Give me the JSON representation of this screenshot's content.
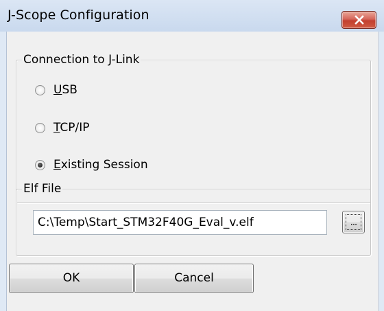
{
  "window": {
    "title": "J-Scope Configuration",
    "close_icon": "close-x-icon",
    "accent_close": "#c8412f"
  },
  "connection": {
    "legend": "Connection to J-Link",
    "options": [
      {
        "prefix": "",
        "mnemonic": "U",
        "rest": "SB",
        "checked": false
      },
      {
        "prefix": "",
        "mnemonic": "T",
        "rest": "CP/IP",
        "checked": false
      },
      {
        "prefix": "",
        "mnemonic": "E",
        "rest": "xisting Session",
        "checked": true
      }
    ]
  },
  "elf": {
    "legend": "Elf File",
    "path": "C:\\Temp\\Start_STM32F40G_Eval_v.elf",
    "browse_label": "..."
  },
  "buttons": {
    "ok": "OK",
    "cancel": "Cancel"
  }
}
